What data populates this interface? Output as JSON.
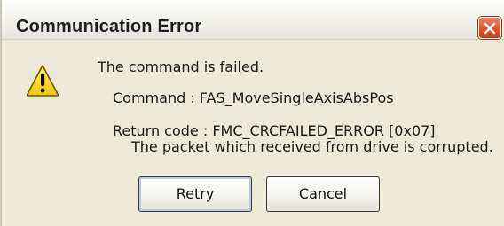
{
  "window": {
    "title": "Communication Error"
  },
  "icons": {
    "message_icon": "warning-icon",
    "close_icon": "close-icon"
  },
  "colors": {
    "close_button": "#d9542b",
    "warning_yellow": "#f5d51a",
    "dialog_background": "#ece9d8"
  },
  "message": {
    "main": "The command is failed.",
    "command_line": "Command : FAS_MoveSingleAxisAbsPos",
    "return_code_line": "Return code : FMC_CRCFAILED_ERROR [0x07]",
    "detail_line": "The packet which received from drive is corrupted."
  },
  "buttons": {
    "retry_label": "Retry",
    "cancel_label": "Cancel"
  }
}
